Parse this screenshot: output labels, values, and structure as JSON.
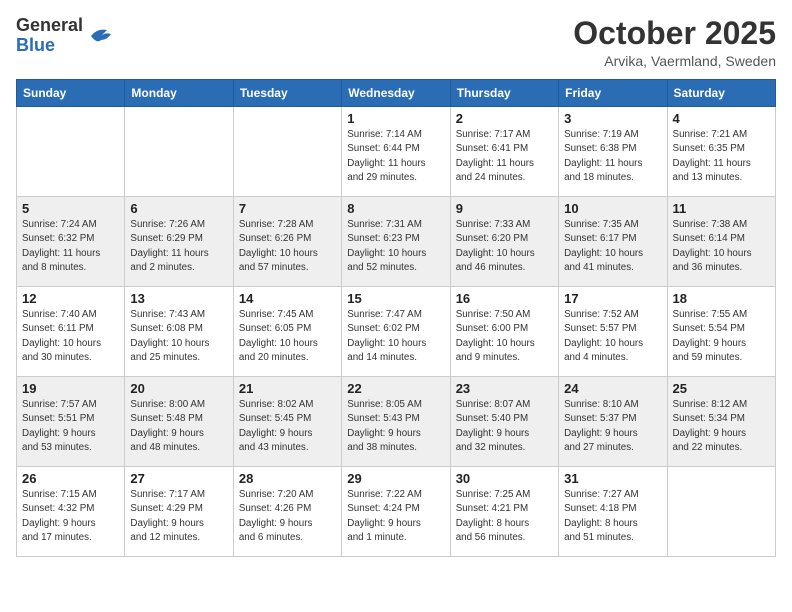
{
  "header": {
    "logo_general": "General",
    "logo_blue": "Blue",
    "title": "October 2025",
    "subtitle": "Arvika, Vaermland, Sweden"
  },
  "days_of_week": [
    "Sunday",
    "Monday",
    "Tuesday",
    "Wednesday",
    "Thursday",
    "Friday",
    "Saturday"
  ],
  "weeks": [
    [
      {
        "day": "",
        "info": ""
      },
      {
        "day": "",
        "info": ""
      },
      {
        "day": "",
        "info": ""
      },
      {
        "day": "1",
        "info": "Sunrise: 7:14 AM\nSunset: 6:44 PM\nDaylight: 11 hours\nand 29 minutes."
      },
      {
        "day": "2",
        "info": "Sunrise: 7:17 AM\nSunset: 6:41 PM\nDaylight: 11 hours\nand 24 minutes."
      },
      {
        "day": "3",
        "info": "Sunrise: 7:19 AM\nSunset: 6:38 PM\nDaylight: 11 hours\nand 18 minutes."
      },
      {
        "day": "4",
        "info": "Sunrise: 7:21 AM\nSunset: 6:35 PM\nDaylight: 11 hours\nand 13 minutes."
      }
    ],
    [
      {
        "day": "5",
        "info": "Sunrise: 7:24 AM\nSunset: 6:32 PM\nDaylight: 11 hours\nand 8 minutes."
      },
      {
        "day": "6",
        "info": "Sunrise: 7:26 AM\nSunset: 6:29 PM\nDaylight: 11 hours\nand 2 minutes."
      },
      {
        "day": "7",
        "info": "Sunrise: 7:28 AM\nSunset: 6:26 PM\nDaylight: 10 hours\nand 57 minutes."
      },
      {
        "day": "8",
        "info": "Sunrise: 7:31 AM\nSunset: 6:23 PM\nDaylight: 10 hours\nand 52 minutes."
      },
      {
        "day": "9",
        "info": "Sunrise: 7:33 AM\nSunset: 6:20 PM\nDaylight: 10 hours\nand 46 minutes."
      },
      {
        "day": "10",
        "info": "Sunrise: 7:35 AM\nSunset: 6:17 PM\nDaylight: 10 hours\nand 41 minutes."
      },
      {
        "day": "11",
        "info": "Sunrise: 7:38 AM\nSunset: 6:14 PM\nDaylight: 10 hours\nand 36 minutes."
      }
    ],
    [
      {
        "day": "12",
        "info": "Sunrise: 7:40 AM\nSunset: 6:11 PM\nDaylight: 10 hours\nand 30 minutes."
      },
      {
        "day": "13",
        "info": "Sunrise: 7:43 AM\nSunset: 6:08 PM\nDaylight: 10 hours\nand 25 minutes."
      },
      {
        "day": "14",
        "info": "Sunrise: 7:45 AM\nSunset: 6:05 PM\nDaylight: 10 hours\nand 20 minutes."
      },
      {
        "day": "15",
        "info": "Sunrise: 7:47 AM\nSunset: 6:02 PM\nDaylight: 10 hours\nand 14 minutes."
      },
      {
        "day": "16",
        "info": "Sunrise: 7:50 AM\nSunset: 6:00 PM\nDaylight: 10 hours\nand 9 minutes."
      },
      {
        "day": "17",
        "info": "Sunrise: 7:52 AM\nSunset: 5:57 PM\nDaylight: 10 hours\nand 4 minutes."
      },
      {
        "day": "18",
        "info": "Sunrise: 7:55 AM\nSunset: 5:54 PM\nDaylight: 9 hours\nand 59 minutes."
      }
    ],
    [
      {
        "day": "19",
        "info": "Sunrise: 7:57 AM\nSunset: 5:51 PM\nDaylight: 9 hours\nand 53 minutes."
      },
      {
        "day": "20",
        "info": "Sunrise: 8:00 AM\nSunset: 5:48 PM\nDaylight: 9 hours\nand 48 minutes."
      },
      {
        "day": "21",
        "info": "Sunrise: 8:02 AM\nSunset: 5:45 PM\nDaylight: 9 hours\nand 43 minutes."
      },
      {
        "day": "22",
        "info": "Sunrise: 8:05 AM\nSunset: 5:43 PM\nDaylight: 9 hours\nand 38 minutes."
      },
      {
        "day": "23",
        "info": "Sunrise: 8:07 AM\nSunset: 5:40 PM\nDaylight: 9 hours\nand 32 minutes."
      },
      {
        "day": "24",
        "info": "Sunrise: 8:10 AM\nSunset: 5:37 PM\nDaylight: 9 hours\nand 27 minutes."
      },
      {
        "day": "25",
        "info": "Sunrise: 8:12 AM\nSunset: 5:34 PM\nDaylight: 9 hours\nand 22 minutes."
      }
    ],
    [
      {
        "day": "26",
        "info": "Sunrise: 7:15 AM\nSunset: 4:32 PM\nDaylight: 9 hours\nand 17 minutes."
      },
      {
        "day": "27",
        "info": "Sunrise: 7:17 AM\nSunset: 4:29 PM\nDaylight: 9 hours\nand 12 minutes."
      },
      {
        "day": "28",
        "info": "Sunrise: 7:20 AM\nSunset: 4:26 PM\nDaylight: 9 hours\nand 6 minutes."
      },
      {
        "day": "29",
        "info": "Sunrise: 7:22 AM\nSunset: 4:24 PM\nDaylight: 9 hours\nand 1 minute."
      },
      {
        "day": "30",
        "info": "Sunrise: 7:25 AM\nSunset: 4:21 PM\nDaylight: 8 hours\nand 56 minutes."
      },
      {
        "day": "31",
        "info": "Sunrise: 7:27 AM\nSunset: 4:18 PM\nDaylight: 8 hours\nand 51 minutes."
      },
      {
        "day": "",
        "info": ""
      }
    ]
  ]
}
